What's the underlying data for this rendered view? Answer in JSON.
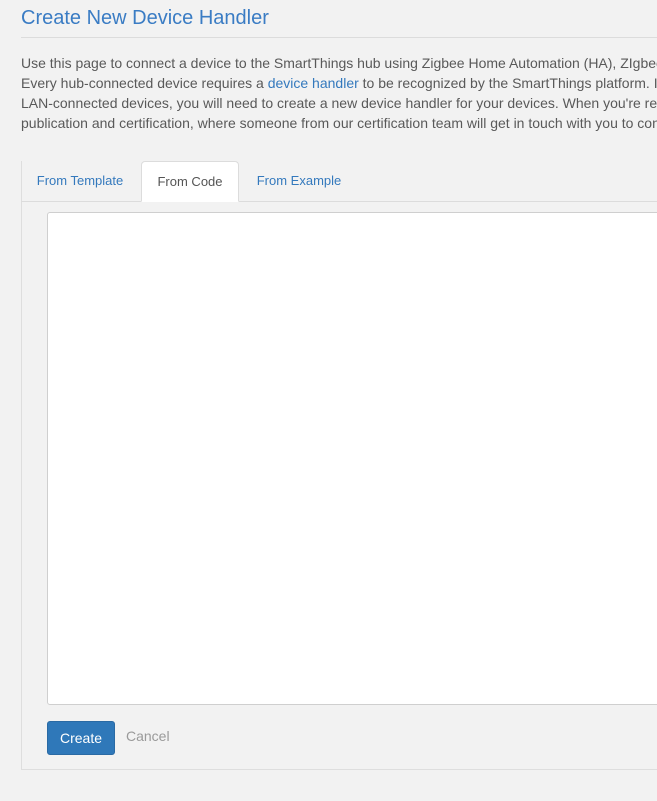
{
  "header": {
    "title": "Create New Device Handler"
  },
  "intro": {
    "line1": "Use this page to connect a device to the SmartThings hub using Zigbee Home Automation (HA), ZIgbee",
    "line2_before_link": "Every hub-connected device requires a ",
    "line2_link": "device handler",
    "line2_after_link": " to be recognized by the SmartThings platform. I",
    "line3": "LAN-connected devices, you will need to create a new device handler for your devices. When you're re",
    "line4": "publication and certification, where someone from our certification team will get in touch with you to con"
  },
  "tabs": [
    {
      "label": "From Template",
      "active": false
    },
    {
      "label": "From Code",
      "active": true
    },
    {
      "label": "From Example",
      "active": false
    }
  ],
  "editor": {
    "value": "",
    "placeholder": ""
  },
  "actions": {
    "create_label": "Create",
    "cancel_label": "Cancel"
  },
  "colors": {
    "accent": "#3479bd",
    "primary_button": "#2f78b9",
    "background": "#f2f2f2"
  }
}
